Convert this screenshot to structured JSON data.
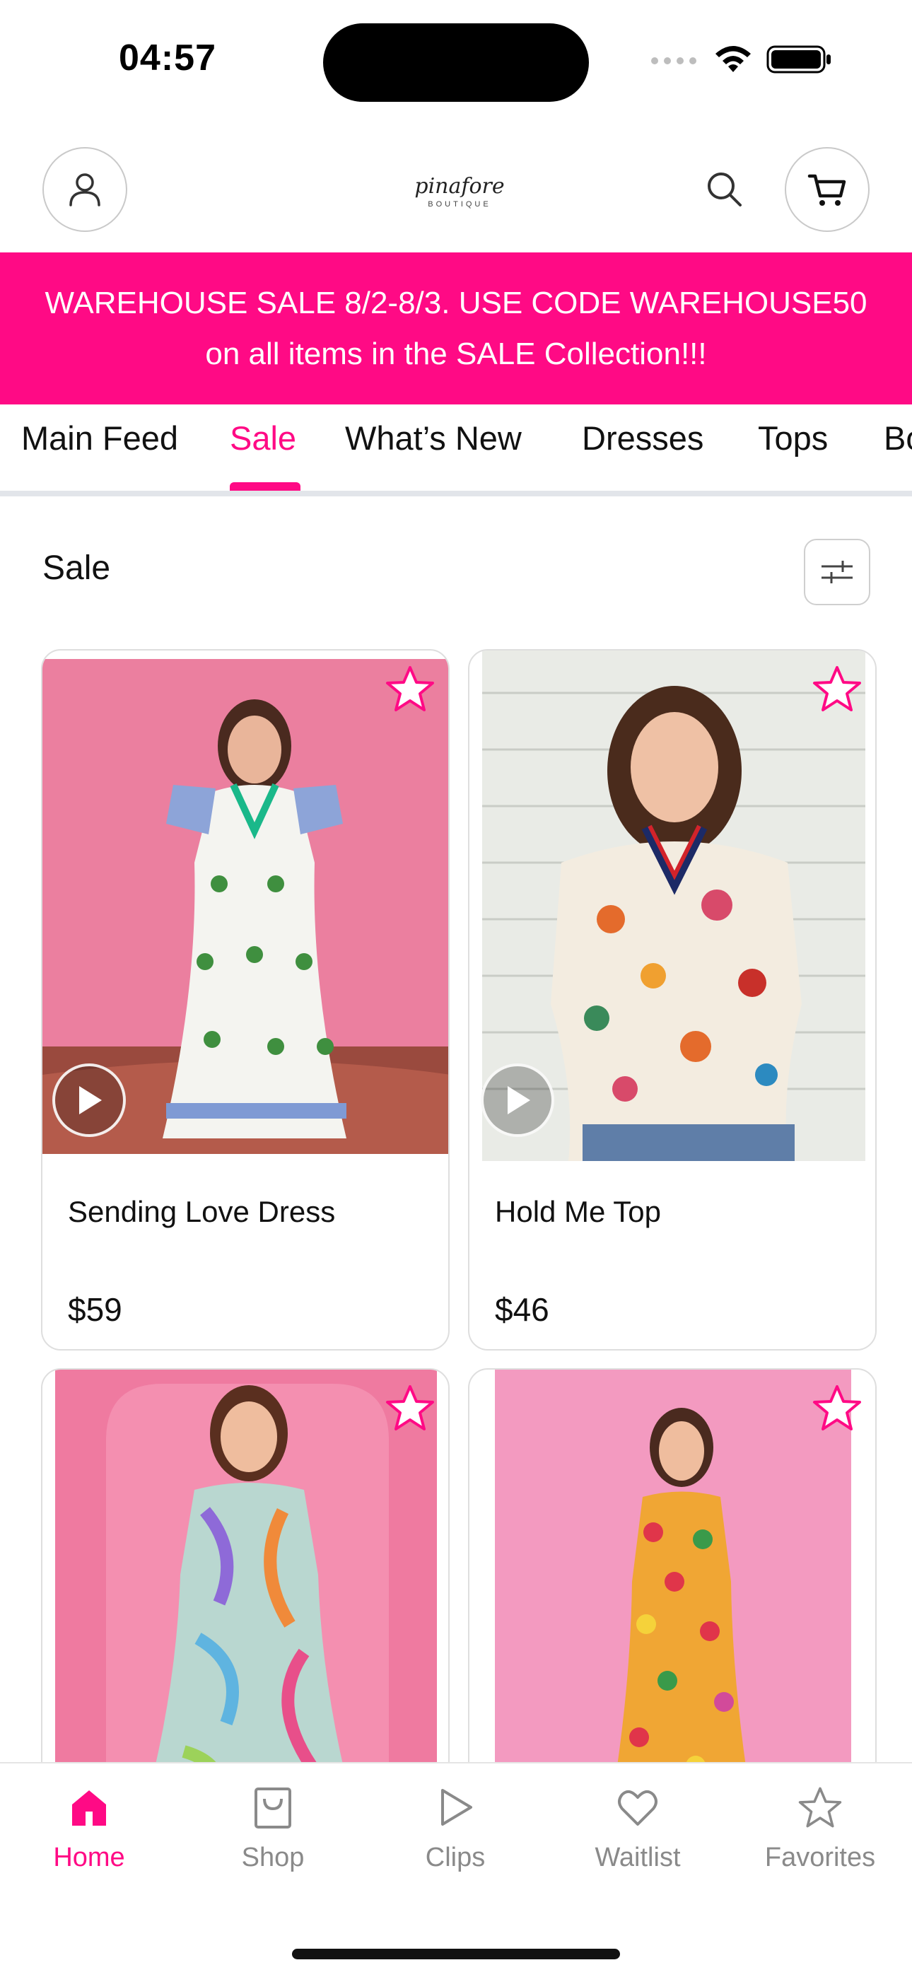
{
  "status": {
    "time": "04:57"
  },
  "header": {
    "logo_script": "pinafore",
    "logo_sub": "BOUTIQUE"
  },
  "promo": {
    "line1": "WAREHOUSE SALE 8/2-8/3. USE CODE WAREHOUSE50",
    "line2": "on all items in the SALE Collection!!!"
  },
  "tabs": [
    {
      "label": "Main Feed"
    },
    {
      "label": "Sale",
      "active": true
    },
    {
      "label": "What’s New"
    },
    {
      "label": "Dresses"
    },
    {
      "label": "Tops"
    },
    {
      "label": "Bo"
    }
  ],
  "section": {
    "title": "Sale"
  },
  "products": [
    {
      "name": "Sending Love Dress",
      "price": "$59",
      "has_video": true,
      "image": "woman in white maxi dress with blue floral print against pink backdrop"
    },
    {
      "name": "Hold Me Top",
      "price": "$46",
      "has_video": true,
      "image": "woman in floral print top against white siding"
    },
    {
      "name": "",
      "price": "",
      "has_video": false,
      "image": "woman in multicolor abstract print dress against pink backdrop"
    },
    {
      "name": "",
      "price": "",
      "has_video": false,
      "image": "woman in colorful floral sleeveless dress against pink backdrop"
    }
  ],
  "bottom_nav": [
    {
      "label": "Home",
      "icon": "home-icon",
      "active": true
    },
    {
      "label": "Shop",
      "icon": "bag-icon"
    },
    {
      "label": "Clips",
      "icon": "play-icon"
    },
    {
      "label": "Waitlist",
      "icon": "heart-icon"
    },
    {
      "label": "Favorites",
      "icon": "star-icon"
    }
  ],
  "colors": {
    "brand": "#ff0a85",
    "muted": "#8a8a8a"
  }
}
